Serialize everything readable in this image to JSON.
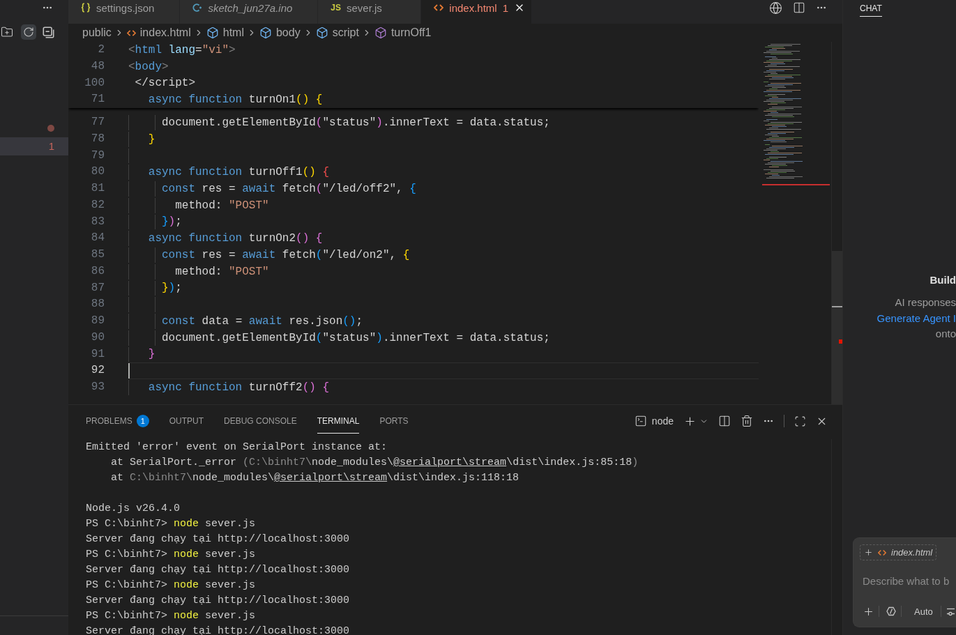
{
  "sidebar": {
    "rows": [
      {
        "kind": "dot",
        "selected": false
      },
      {
        "kind": "count",
        "count": "1",
        "selected": true
      }
    ]
  },
  "tabs": [
    {
      "label": "settings.json",
      "kind": "json",
      "preview": false,
      "has_errors": false,
      "selected": false
    },
    {
      "label": "sketch_jun27a.ino",
      "kind": "cpp",
      "preview": true,
      "has_errors": false,
      "selected": false
    },
    {
      "label": "sever.js",
      "kind": "js",
      "icon_text": "JS",
      "preview": false,
      "has_errors": false,
      "selected": false
    },
    {
      "label": "index.html",
      "kind": "html",
      "problem_count": "1",
      "preview": false,
      "has_errors": true,
      "selected": true
    }
  ],
  "breadcrumb": [
    {
      "label": "public",
      "kind": "plain"
    },
    {
      "label": "index.html",
      "kind": "html"
    },
    {
      "label": "html",
      "kind": "element"
    },
    {
      "label": "body",
      "kind": "element"
    },
    {
      "label": "script",
      "kind": "element"
    },
    {
      "label": "turnOff1",
      "kind": "function"
    }
  ],
  "editor": {
    "sticky_lines": [
      {
        "number": "2",
        "tokens": [
          {
            "kind": "punct",
            "text": "<"
          },
          {
            "kind": "tag",
            "text": "html"
          },
          {
            "kind": "attr",
            "text": " lang"
          },
          {
            "kind": "plain",
            "text": "="
          },
          {
            "kind": "string",
            "text": "\"vi\""
          },
          {
            "kind": "punct",
            "text": ">"
          }
        ]
      },
      {
        "number": "48",
        "tokens": [
          {
            "kind": "punct",
            "text": "<"
          },
          {
            "kind": "tag",
            "text": "body"
          },
          {
            "kind": "punct",
            "text": ">"
          }
        ]
      },
      {
        "number": "100",
        "tokens": [
          {
            "kind": "plain",
            "text": " </script>"
          }
        ]
      },
      {
        "number": "71",
        "tokens": [
          {
            "kind": "keyword",
            "text": "   async function"
          },
          {
            "kind": "plain",
            "text": " turnOn1"
          },
          {
            "kind": "bracket_gold",
            "text": "() {"
          }
        ]
      }
    ],
    "lines": [
      {
        "number": "77",
        "current": false,
        "tokens": [
          {
            "kind": "plain",
            "text": "     document.getElementById"
          },
          {
            "kind": "bracket_orchid",
            "text": "("
          },
          {
            "kind": "plain",
            "text": "\"status\""
          },
          {
            "kind": "bracket_orchid",
            "text": ")"
          },
          {
            "kind": "plain",
            "text": ".innerText = data.status;"
          }
        ]
      },
      {
        "number": "78",
        "current": false,
        "tokens": [
          {
            "kind": "bracket_gold",
            "text": "   }"
          }
        ]
      },
      {
        "number": "79",
        "current": false
      },
      {
        "number": "80",
        "current": false,
        "tokens": [
          {
            "kind": "keyword",
            "text": "   async function"
          },
          {
            "kind": "plain",
            "text": " turnOff1"
          },
          {
            "kind": "bracket_gold",
            "text": "()"
          },
          {
            "kind": "bracket_error",
            "text": " {"
          }
        ]
      },
      {
        "number": "81",
        "current": false,
        "tokens": [
          {
            "kind": "keyword",
            "text": "     const"
          },
          {
            "kind": "plain",
            "text": " res = "
          },
          {
            "kind": "keyword",
            "text": "await"
          },
          {
            "kind": "plain",
            "text": " fetch"
          },
          {
            "kind": "bracket_orchid",
            "text": "("
          },
          {
            "kind": "plain",
            "text": "\"/led/off2\", "
          },
          {
            "kind": "bracket_blue",
            "text": "{"
          }
        ]
      },
      {
        "number": "82",
        "current": false,
        "tokens": [
          {
            "kind": "plain",
            "text": "       method: "
          },
          {
            "kind": "string",
            "text": "\"POST\""
          }
        ]
      },
      {
        "number": "83",
        "current": false,
        "tokens": [
          {
            "kind": "bracket_blue",
            "text": "     }"
          },
          {
            "kind": "bracket_orchid",
            "text": ")"
          },
          {
            "kind": "plain",
            "text": ";"
          }
        ]
      },
      {
        "number": "84",
        "current": false,
        "tokens": [
          {
            "kind": "keyword",
            "text": "   async function"
          },
          {
            "kind": "plain",
            "text": " turnOn2"
          },
          {
            "kind": "bracket_orchid",
            "text": "() {"
          }
        ]
      },
      {
        "number": "85",
        "current": false,
        "tokens": [
          {
            "kind": "keyword",
            "text": "     const"
          },
          {
            "kind": "plain",
            "text": " res = "
          },
          {
            "kind": "keyword",
            "text": "await"
          },
          {
            "kind": "plain",
            "text": " fetch"
          },
          {
            "kind": "bracket_blue",
            "text": "("
          },
          {
            "kind": "plain",
            "text": "\"/led/on2\", "
          },
          {
            "kind": "bracket_gold",
            "text": "{"
          }
        ]
      },
      {
        "number": "86",
        "current": false,
        "tokens": [
          {
            "kind": "plain",
            "text": "       method: "
          },
          {
            "kind": "string",
            "text": "\"POST\""
          }
        ]
      },
      {
        "number": "87",
        "current": false,
        "tokens": [
          {
            "kind": "bracket_gold",
            "text": "     }"
          },
          {
            "kind": "bracket_blue",
            "text": ")"
          },
          {
            "kind": "plain",
            "text": ";"
          }
        ]
      },
      {
        "number": "88",
        "current": false
      },
      {
        "number": "89",
        "current": false,
        "tokens": [
          {
            "kind": "keyword",
            "text": "     const"
          },
          {
            "kind": "plain",
            "text": " data = "
          },
          {
            "kind": "keyword",
            "text": "await"
          },
          {
            "kind": "plain",
            "text": " res.json"
          },
          {
            "kind": "bracket_blue",
            "text": "()"
          },
          {
            "kind": "plain",
            "text": ";"
          }
        ]
      },
      {
        "number": "90",
        "current": false,
        "tokens": [
          {
            "kind": "plain",
            "text": "     document.getElementById"
          },
          {
            "kind": "bracket_blue",
            "text": "("
          },
          {
            "kind": "plain",
            "text": "\"status\""
          },
          {
            "kind": "bracket_blue",
            "text": ")"
          },
          {
            "kind": "plain",
            "text": ".innerText = data.status;"
          }
        ]
      },
      {
        "number": "91",
        "current": false,
        "tokens": [
          {
            "kind": "bracket_orchid",
            "text": "   }"
          }
        ]
      },
      {
        "number": "92",
        "current": true
      },
      {
        "number": "93",
        "current": false,
        "tokens": [
          {
            "kind": "keyword",
            "text": "   async function"
          },
          {
            "kind": "plain",
            "text": " turnOff2"
          },
          {
            "kind": "bracket_orchid",
            "text": "() {"
          }
        ]
      }
    ]
  },
  "panel": {
    "tabs": [
      {
        "label": "PROBLEMS",
        "badge": "1",
        "selected": false
      },
      {
        "label": "OUTPUT",
        "selected": false
      },
      {
        "label": "DEBUG CONSOLE",
        "selected": false
      },
      {
        "label": "TERMINAL",
        "selected": true
      },
      {
        "label": "PORTS",
        "selected": false
      }
    ],
    "shell": "node",
    "terminal": [
      {
        "kind": "text",
        "segments": [
          {
            "kind": "plain",
            "text": "Emitted 'error' event on SerialPort instance at:"
          }
        ]
      },
      {
        "kind": "text",
        "segments": [
          {
            "kind": "plain",
            "text": "    at SerialPort._error "
          },
          {
            "kind": "dim",
            "text": "(C:\\binht7\\"
          },
          {
            "kind": "plain",
            "text": "node_modules\\"
          },
          {
            "kind": "link",
            "text": "@serialport\\stream"
          },
          {
            "kind": "plain",
            "text": "\\dist\\index.js:85:18"
          },
          {
            "kind": "dim",
            "text": ")"
          }
        ]
      },
      {
        "kind": "text",
        "segments": [
          {
            "kind": "plain",
            "text": "    at "
          },
          {
            "kind": "dim",
            "text": "C:\\binht7\\"
          },
          {
            "kind": "plain",
            "text": "node_modules\\"
          },
          {
            "kind": "link",
            "text": "@serialport\\stream"
          },
          {
            "kind": "plain",
            "text": "\\dist\\index.js:118:18"
          }
        ]
      },
      {
        "kind": "blank"
      },
      {
        "kind": "text",
        "segments": [
          {
            "kind": "plain",
            "text": "Node.js v26.4.0"
          }
        ]
      },
      {
        "kind": "text",
        "segments": [
          {
            "kind": "plain",
            "text": "PS C:\\binht7> "
          },
          {
            "kind": "command",
            "text": "node"
          },
          {
            "kind": "plain",
            "text": " sever.js"
          }
        ]
      },
      {
        "kind": "text",
        "segments": [
          {
            "kind": "plain",
            "text": "Server đang chạy tại http://localhost:3000"
          }
        ]
      },
      {
        "kind": "text",
        "segments": [
          {
            "kind": "plain",
            "text": "PS C:\\binht7> "
          },
          {
            "kind": "command",
            "text": "node"
          },
          {
            "kind": "plain",
            "text": " sever.js"
          }
        ]
      },
      {
        "kind": "text",
        "segments": [
          {
            "kind": "plain",
            "text": "Server đang chạy tại http://localhost:3000"
          }
        ]
      },
      {
        "kind": "text",
        "segments": [
          {
            "kind": "plain",
            "text": "PS C:\\binht7> "
          },
          {
            "kind": "command",
            "text": "node"
          },
          {
            "kind": "plain",
            "text": " sever.js"
          }
        ]
      },
      {
        "kind": "text",
        "segments": [
          {
            "kind": "plain",
            "text": "Server đang chạy tại http://localhost:3000"
          }
        ]
      },
      {
        "kind": "text",
        "segments": [
          {
            "kind": "plain",
            "text": "PS C:\\binht7> "
          },
          {
            "kind": "command",
            "text": "node"
          },
          {
            "kind": "plain",
            "text": " sever.js"
          }
        ]
      },
      {
        "kind": "text",
        "segments": [
          {
            "kind": "plain",
            "text": "Server đang chạy tại http://localhost:3000"
          }
        ]
      }
    ]
  },
  "chat": {
    "tabs": [
      {
        "label": "CHAT",
        "selected": true
      }
    ],
    "welcome": {
      "title": "Build",
      "lines": [
        {
          "kind": "text",
          "text": "AI responses"
        },
        {
          "kind": "link",
          "text": "Generate Agent I"
        },
        {
          "kind": "text",
          "text": "onto"
        }
      ]
    },
    "composer": {
      "context_file": "index.html",
      "placeholder": "Describe what to b",
      "mode": "Auto"
    }
  }
}
